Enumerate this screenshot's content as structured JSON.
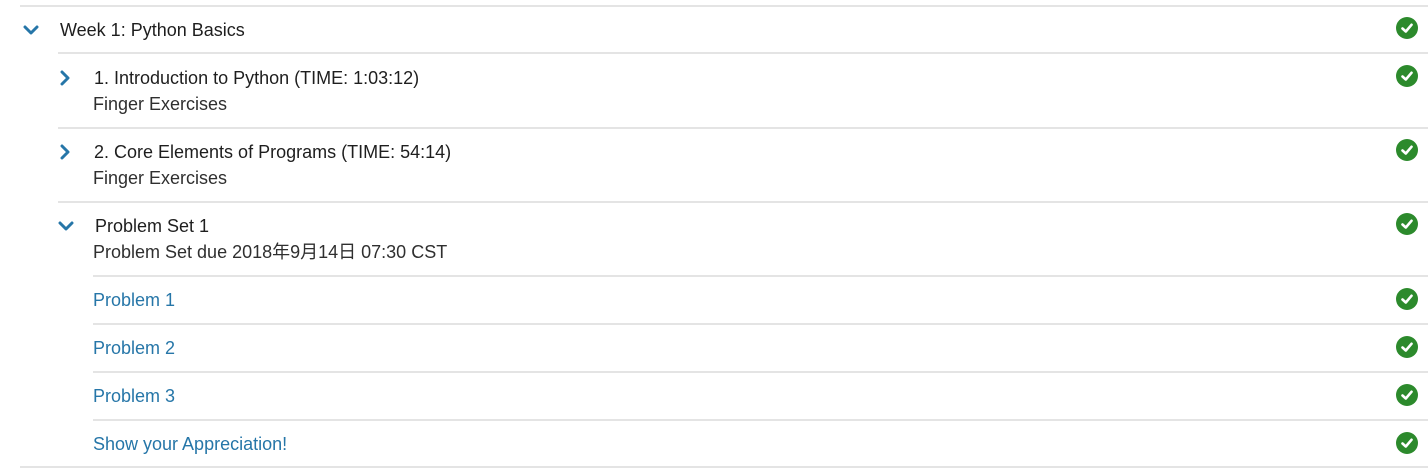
{
  "colors": {
    "chevron": "#2676a8",
    "link": "#2676a8",
    "check": "#2c8a2c",
    "divider": "#e4e4e4"
  },
  "week": {
    "title": "Week 1: Python Basics",
    "expanded": true,
    "icon": "chevron-down-icon",
    "status_icon": "check-circle-icon"
  },
  "lessons": [
    {
      "title": "1. Introduction to Python (TIME: 1:03:12)",
      "subtitle": "Finger Exercises",
      "expanded": false,
      "icon": "chevron-right-icon",
      "status_icon": "check-circle-icon"
    },
    {
      "title": "2. Core Elements of Programs (TIME: 54:14)",
      "subtitle": "Finger Exercises",
      "expanded": false,
      "icon": "chevron-right-icon",
      "status_icon": "check-circle-icon"
    }
  ],
  "problem_set": {
    "title": "Problem Set 1",
    "due": "Problem Set due 2018年9月14日 07:30 CST",
    "expanded": true,
    "icon": "chevron-down-icon",
    "status_icon": "check-circle-icon",
    "items": [
      {
        "label": "Problem 1",
        "status_icon": "check-circle-icon"
      },
      {
        "label": "Problem 2",
        "status_icon": "check-circle-icon"
      },
      {
        "label": "Problem 3",
        "status_icon": "check-circle-icon"
      },
      {
        "label": "Show your Appreciation!",
        "status_icon": "check-circle-icon"
      }
    ]
  }
}
